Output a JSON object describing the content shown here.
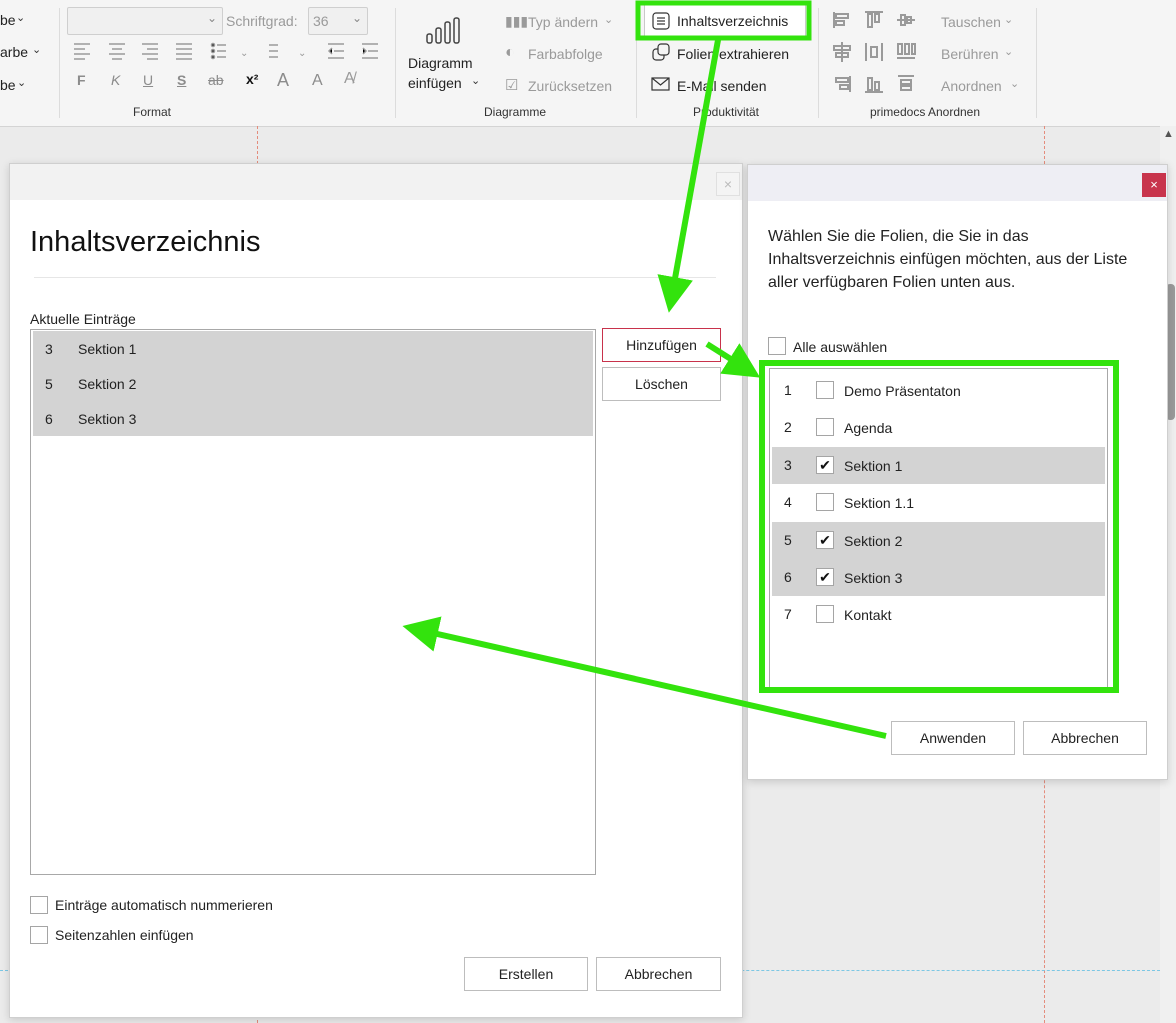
{
  "ribbon": {
    "left_partial": [
      "be",
      "arbe",
      "be"
    ],
    "schriftgrad_label": "Schriftgrad:",
    "schriftgrad_value": "36",
    "format_bold": "F",
    "format_italic": "K",
    "format_underline": "U",
    "format_shadow": "S",
    "format_strike": "ab",
    "format_super": "x²",
    "format_grow": "A",
    "format_shrink": "A",
    "group_format": "Format",
    "diagramm_line1": "Diagramm",
    "diagramm_line2": "einfügen",
    "typ_aendern": "Typ ändern",
    "farbabfolge": "Farbabfolge",
    "zuruecksetzen": "Zurücksetzen",
    "group_diagramme": "Diagramme",
    "inhaltsverzeichnis": "Inhaltsverzeichnis",
    "folien_extrahieren": "Folien extrahieren",
    "email_senden": "E-Mail senden",
    "group_produktivitaet": "Produktivität",
    "tauschen": "Tauschen",
    "beruehren": "Berühren",
    "anordnen": "Anordnen",
    "group_anordnen": "primedocs Anordnen"
  },
  "dialog_toc": {
    "title": "Inhaltsverzeichnis",
    "current_label": "Aktuelle Einträge",
    "entries": [
      {
        "num": "3",
        "label": "Sektion 1"
      },
      {
        "num": "5",
        "label": "Sektion 2"
      },
      {
        "num": "6",
        "label": "Sektion 3"
      }
    ],
    "add_button": "Hinzufügen",
    "delete_button": "Löschen",
    "auto_number_label": "Einträge automatisch nummerieren",
    "page_numbers_label": "Seitenzahlen einfügen",
    "create_button": "Erstellen",
    "cancel_button": "Abbrechen"
  },
  "dialog_select": {
    "close_icon": "×",
    "description": "Wählen Sie die Folien, die Sie in das Inhaltsverzeichnis einfügen möchten, aus der Liste aller verfügbaren Folien unten aus.",
    "select_all_label": "Alle auswählen",
    "slides": [
      {
        "num": "1",
        "label": "Demo Präsentaton",
        "checked": false
      },
      {
        "num": "2",
        "label": "Agenda",
        "checked": false
      },
      {
        "num": "3",
        "label": "Sektion 1",
        "checked": true
      },
      {
        "num": "4",
        "label": "Sektion 1.1",
        "checked": false
      },
      {
        "num": "5",
        "label": "Sektion 2",
        "checked": true
      },
      {
        "num": "6",
        "label": "Sektion 3",
        "checked": true
      },
      {
        "num": "7",
        "label": "Kontakt",
        "checked": false
      }
    ],
    "apply_button": "Anwenden",
    "cancel_button": "Abbrechen"
  },
  "colors": {
    "highlight_green": "#33e30d",
    "accent_red": "#c8344c",
    "selection_gray": "#d3d3d3"
  }
}
